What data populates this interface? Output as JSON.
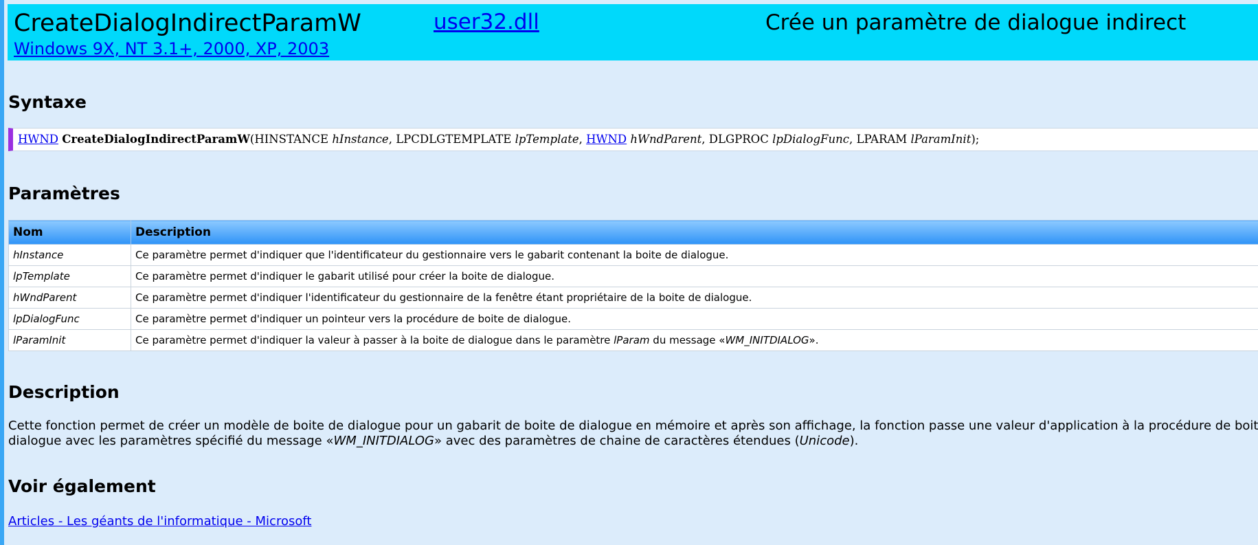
{
  "header": {
    "function_name": "CreateDialogIndirectParamW",
    "dll_link": "user32.dll",
    "summary": "Crée un paramètre de dialogue indirect",
    "os_link": "Windows 9X, NT 3.1+, 2000, XP, 2003"
  },
  "syntax": {
    "heading": "Syntaxe",
    "return_type": "HWND",
    "function_name": "CreateDialogIndirectParamW",
    "open_paren": "(",
    "p1_type": "HINSTANCE",
    "p1_name": "hInstance",
    "p2_type": "LPCDLGTEMPLATE",
    "p2_name": "lpTemplate",
    "p3_type": "HWND",
    "p3_name": "hWndParent",
    "p4_type": "DLGPROC",
    "p4_name": "lpDialogFunc",
    "p5_type": "LPARAM",
    "p5_name": "lParamInit",
    "close": ");",
    "separator": ", "
  },
  "parameters": {
    "heading": "Paramètres",
    "col_name": "Nom",
    "col_description": "Description",
    "rows": [
      {
        "name": "hInstance",
        "description": "Ce paramètre permet d'indiquer que l'identificateur du gestionnaire vers le gabarit contenant la boite de dialogue."
      },
      {
        "name": "lpTemplate",
        "description": "Ce paramètre permet d'indiquer le gabarit utilisé pour créer la boite de dialogue."
      },
      {
        "name": "hWndParent",
        "description": "Ce paramètre permet d'indiquer l'identificateur du gestionnaire de la fenêtre étant propriétaire de la boite de dialogue."
      },
      {
        "name": "lpDialogFunc",
        "description": "Ce paramètre permet d'indiquer un pointeur vers la procédure de boite de dialogue."
      },
      {
        "name": "lParamInit",
        "description_pre": "Ce paramètre permet d'indiquer la valeur à passer à la boite de dialogue dans le paramètre ",
        "description_em1": "lParam",
        "description_mid": " du message «",
        "description_em2": "WM_INITDIALOG",
        "description_post": "»."
      }
    ]
  },
  "description": {
    "heading": "Description",
    "text_pre": "Cette fonction permet de créer un modèle de boite de dialogue pour un gabarit de boite de dialogue en mémoire et après son affichage, la fonction passe une valeur d'application à la procédure de boite de dialogue avec les paramètres spécifié du message «",
    "em1": "WM_INITDIALOG",
    "text_mid": "» avec des paramètres de chaine de caractères étendues (",
    "em2": "Unicode",
    "text_post": ")."
  },
  "see_also": {
    "heading": "Voir également",
    "link": "Articles - Les géants de l'informatique - Microsoft"
  }
}
